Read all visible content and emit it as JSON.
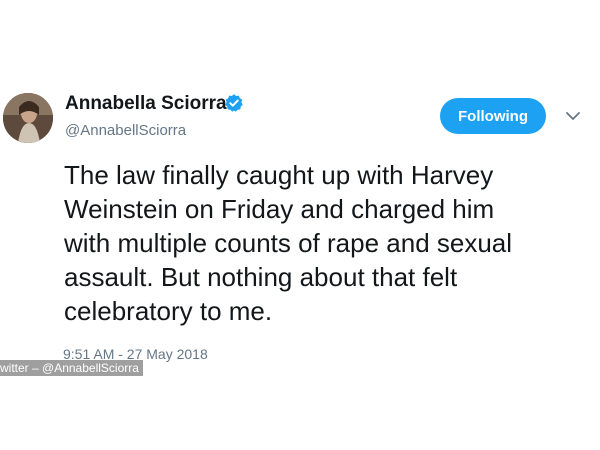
{
  "tweet": {
    "author": {
      "display_name": "Annabella Sciorra",
      "handle": "@AnnabellSciorra",
      "verified": true,
      "avatar": "profile-photo"
    },
    "follow_button_label": "Following",
    "text_lines": [
      "The law finally caught up with Harvey",
      "Weinstein on Friday and charged him",
      "with multiple counts of rape and sexual",
      "assault. But nothing about that felt",
      "celebratory to me."
    ],
    "timestamp": "9:51 AM - 27 May 2018"
  },
  "photo_credit": "witter – @AnnabellSciorra",
  "colors": {
    "accent": "#1da1f2",
    "text": "#14171a",
    "secondary_text": "#657786"
  },
  "icons": {
    "verified": "verified-badge-icon",
    "menu": "chevron-down-icon"
  }
}
